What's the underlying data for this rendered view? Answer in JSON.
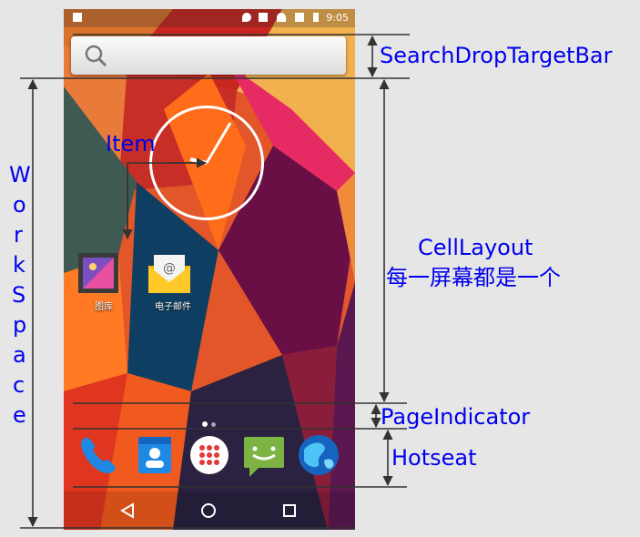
{
  "labels": {
    "search_drop_target_bar": "SearchDropTargetBar",
    "item": "Item",
    "cell_layout": "CellLayout",
    "cell_layout_note": "每一屏幕都是一个",
    "page_indicator": "PageIndicator",
    "hotseat": "Hotseat",
    "workspace_letters": [
      "W",
      "o",
      "r",
      "k",
      "S",
      "p",
      "a",
      "c",
      "e"
    ]
  },
  "phone": {
    "status_time": "9:05",
    "apps": [
      {
        "label": "图库",
        "icon": "gallery-icon"
      },
      {
        "label": "电子邮件",
        "icon": "email-icon"
      }
    ],
    "hotseat_icons": [
      "phone-icon",
      "contacts-icon",
      "all-apps-icon",
      "messaging-icon",
      "browser-icon"
    ],
    "nav_icons": [
      "back-icon",
      "home-icon",
      "recents-icon"
    ]
  },
  "colors": {
    "annotation_text": "#0000ee",
    "line": "#333333",
    "background": "#e6e6e6"
  }
}
